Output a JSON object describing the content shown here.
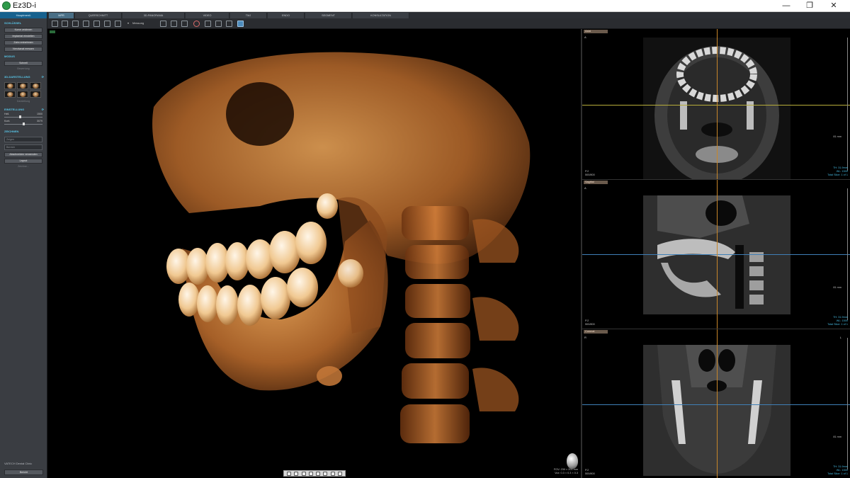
{
  "window": {
    "title": "Ez3D-i",
    "minimize_glyph": "—",
    "restore_glyph": "❐",
    "close_glyph": "✕"
  },
  "sidebar": {
    "header": "Hauptmenü",
    "sections": [
      {
        "title": "SCHLÜSSEL",
        "buttons": [
          "Kurve zeichnen",
          "Implantat einstellen",
          "Zahn entnehmen",
          "Nervkanal messen"
        ]
      },
      {
        "title": "MODUS",
        "buttons": [
          "Schnell",
          "Bewertung"
        ]
      },
      {
        "title": "3D-DARSTELLUNG",
        "buttons": [
          "Darstellung"
        ]
      },
      {
        "title": "EINSTELLUNG",
        "sliders": [
          {
            "label": "Hell.",
            "value": "1500",
            "position": 0.42
          },
          {
            "label": "Kont.",
            "value": "3079",
            "position": 0.5
          }
        ]
      },
      {
        "title": "ZEICHNEN",
        "selects": [
          "Zeigen",
          "Bereich"
        ],
        "buttons": [
          "Abschneiden verwenden",
          "Layout",
          "Zeichne..."
        ]
      }
    ],
    "footer": "VATECH Dental Clinic",
    "bottom_button": "Bericht"
  },
  "tabs": [
    "MPR",
    "QUERSCHNITT",
    "3D-PANORAMA",
    "VIDEO",
    "TMJ",
    "ENDO",
    "SEGMENT",
    "KONSULTATION"
  ],
  "toolbar": {
    "measure_label": "Messung"
  },
  "view3d": {
    "info_lines": [
      "FOV: 230 × 200 mm",
      "Vox: 0.3 × 0.3 × 0.3"
    ]
  },
  "slices": [
    {
      "title": "Axial",
      "top_left": "A",
      "top_right": "",
      "mm": "81 mm",
      "left_info": [
        "P.2",
        "500/800"
      ],
      "right_info": [
        "TH: 31.9mm",
        "WL: 1500",
        "Total Slice: 1 of 1"
      ]
    },
    {
      "title": "Sagittal",
      "top_left": "A",
      "top_right": "",
      "mm": "81 mm",
      "left_info": [
        "P.2",
        "500/800"
      ],
      "right_info": [
        "TH: 31.9mm",
        "WL: 1500",
        "Total Slice: 1 of 1"
      ]
    },
    {
      "title": "Coronal",
      "top_left": "R",
      "top_right": "L",
      "mm": "81 mm",
      "left_info": [
        "P.2",
        "500/800"
      ],
      "right_info": [
        "TH: 31.9mm",
        "WL: 1500",
        "Total Slice: 1 of 1"
      ]
    }
  ],
  "colors": {
    "accent": "#58c4e6",
    "crosshair_vertical": "#c8862a",
    "crosshair_horizontal_axial": "#b7ad3a",
    "crosshair_horizontal_other": "#3f7fb6",
    "bone": "#d9823f"
  }
}
